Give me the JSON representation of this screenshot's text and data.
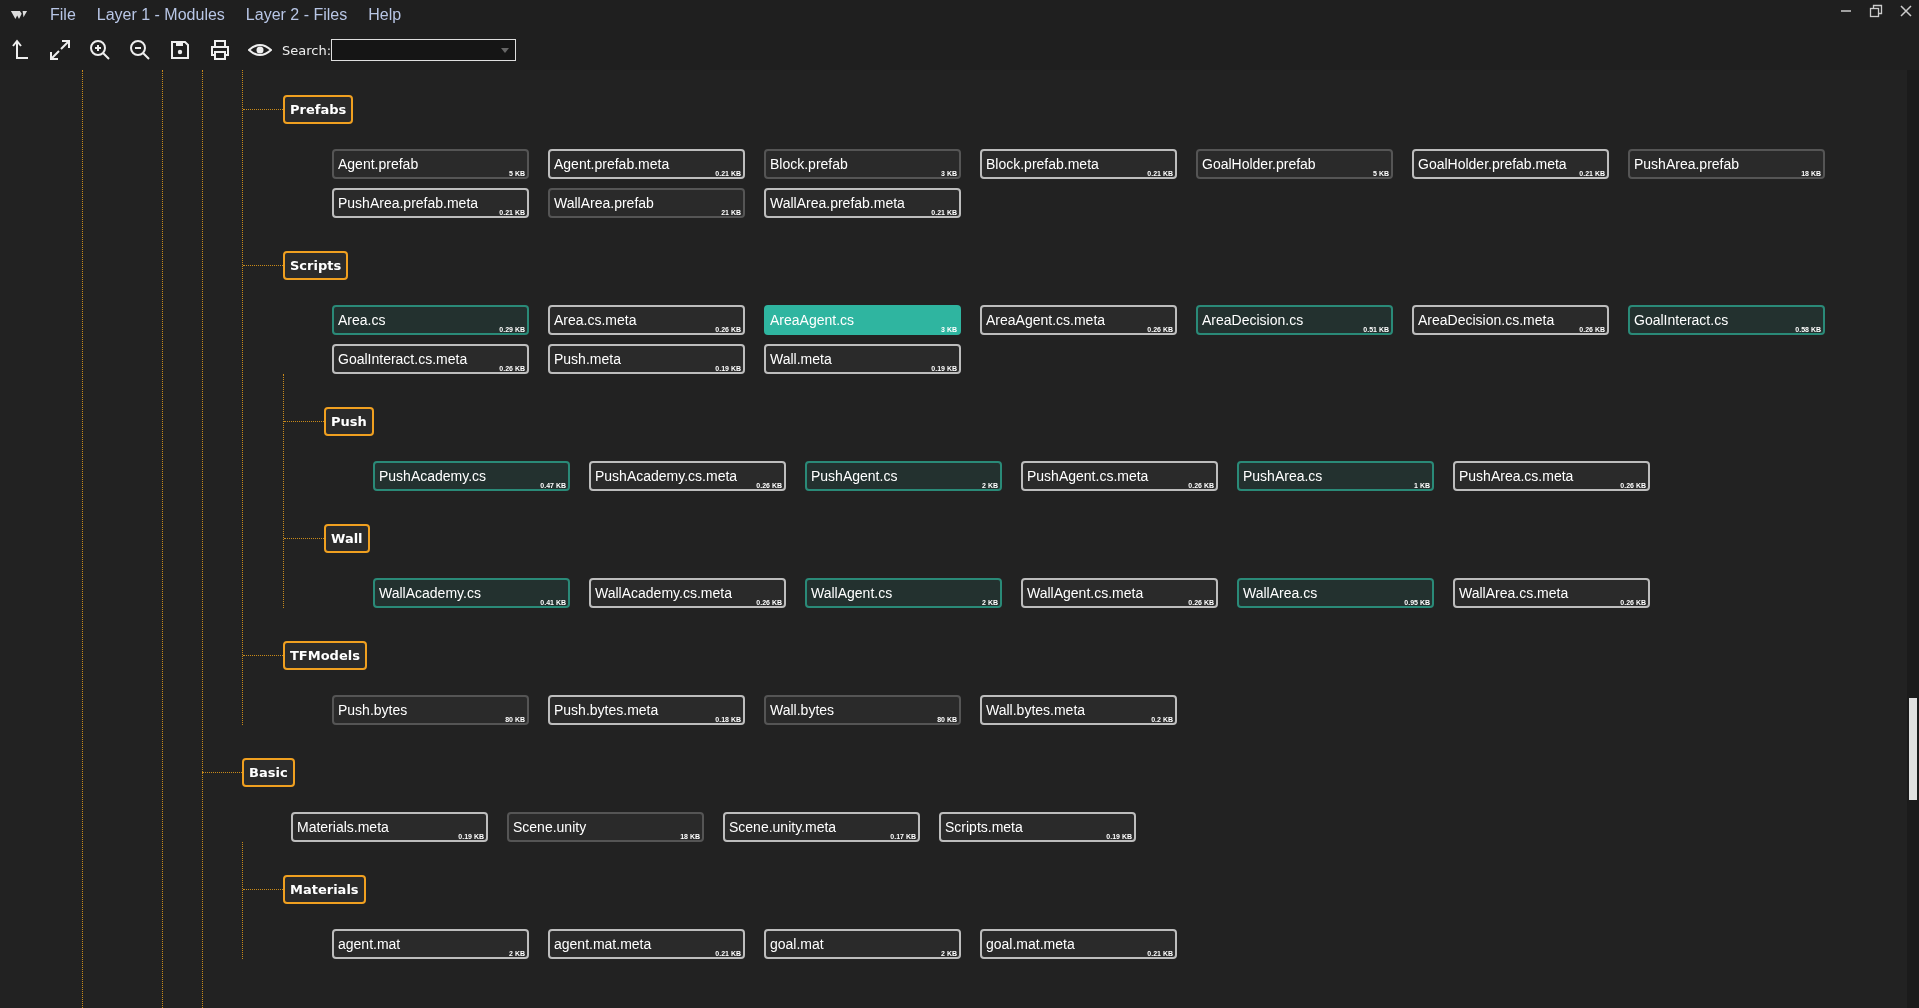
{
  "menu": [
    "File",
    "Layer 1 - Modules",
    "Layer 2 - Files",
    "Help"
  ],
  "search": {
    "label": "Search:"
  },
  "tree": [
    {
      "children": [
        {
          "name": "Prefabs",
          "files": [
            {
              "name": "Agent.prefab",
              "size": "5 KB",
              "kind": "file",
              "selected": false
            },
            {
              "name": "Agent.prefab.meta",
              "size": "0.21 KB",
              "kind": "meta",
              "selected": false
            },
            {
              "name": "Block.prefab",
              "size": "3 KB",
              "kind": "file",
              "selected": false
            },
            {
              "name": "Block.prefab.meta",
              "size": "0.21 KB",
              "kind": "meta",
              "selected": false
            },
            {
              "name": "GoalHolder.prefab",
              "size": "5 KB",
              "kind": "file",
              "selected": false
            },
            {
              "name": "GoalHolder.prefab.meta",
              "size": "0.21 KB",
              "kind": "meta",
              "selected": false
            },
            {
              "name": "PushArea.prefab",
              "size": "18 KB",
              "kind": "file",
              "selected": false
            },
            {
              "name": "PushArea.prefab.meta",
              "size": "0.21 KB",
              "kind": "meta",
              "selected": false
            },
            {
              "name": "WallArea.prefab",
              "size": "21 KB",
              "kind": "file",
              "selected": false
            },
            {
              "name": "WallArea.prefab.meta",
              "size": "0.21 KB",
              "kind": "meta",
              "selected": false
            }
          ]
        },
        {
          "name": "Scripts",
          "files": [
            {
              "name": "Area.cs",
              "size": "0.29 KB",
              "kind": "script",
              "selected": false
            },
            {
              "name": "Area.cs.meta",
              "size": "0.26 KB",
              "kind": "meta",
              "selected": false
            },
            {
              "name": "AreaAgent.cs",
              "size": "3 KB",
              "kind": "script",
              "selected": true
            },
            {
              "name": "AreaAgent.cs.meta",
              "size": "0.26 KB",
              "kind": "meta",
              "selected": false
            },
            {
              "name": "AreaDecision.cs",
              "size": "0.51 KB",
              "kind": "script",
              "selected": false
            },
            {
              "name": "AreaDecision.cs.meta",
              "size": "0.26 KB",
              "kind": "meta",
              "selected": false
            },
            {
              "name": "GoalInteract.cs",
              "size": "0.58 KB",
              "kind": "script",
              "selected": false
            },
            {
              "name": "GoalInteract.cs.meta",
              "size": "0.26 KB",
              "kind": "meta",
              "selected": false
            },
            {
              "name": "Push.meta",
              "size": "0.19 KB",
              "kind": "meta",
              "selected": false
            },
            {
              "name": "Wall.meta",
              "size": "0.19 KB",
              "kind": "meta",
              "selected": false
            }
          ],
          "children": [
            {
              "name": "Push",
              "files": [
                {
                  "name": "PushAcademy.cs",
                  "size": "0.47 KB",
                  "kind": "script",
                  "selected": false
                },
                {
                  "name": "PushAcademy.cs.meta",
                  "size": "0.26 KB",
                  "kind": "meta",
                  "selected": false
                },
                {
                  "name": "PushAgent.cs",
                  "size": "2 KB",
                  "kind": "script",
                  "selected": false
                },
                {
                  "name": "PushAgent.cs.meta",
                  "size": "0.26 KB",
                  "kind": "meta",
                  "selected": false
                },
                {
                  "name": "PushArea.cs",
                  "size": "1 KB",
                  "kind": "script",
                  "selected": false
                },
                {
                  "name": "PushArea.cs.meta",
                  "size": "0.26 KB",
                  "kind": "meta",
                  "selected": false
                }
              ]
            },
            {
              "name": "Wall",
              "files": [
                {
                  "name": "WallAcademy.cs",
                  "size": "0.41 KB",
                  "kind": "script",
                  "selected": false
                },
                {
                  "name": "WallAcademy.cs.meta",
                  "size": "0.26 KB",
                  "kind": "meta",
                  "selected": false
                },
                {
                  "name": "WallAgent.cs",
                  "size": "2 KB",
                  "kind": "script",
                  "selected": false
                },
                {
                  "name": "WallAgent.cs.meta",
                  "size": "0.26 KB",
                  "kind": "meta",
                  "selected": false
                },
                {
                  "name": "WallArea.cs",
                  "size": "0.95 KB",
                  "kind": "script",
                  "selected": false
                },
                {
                  "name": "WallArea.cs.meta",
                  "size": "0.26 KB",
                  "kind": "meta",
                  "selected": false
                }
              ]
            }
          ]
        },
        {
          "name": "TFModels",
          "files": [
            {
              "name": "Push.bytes",
              "size": "80 KB",
              "kind": "file",
              "selected": false
            },
            {
              "name": "Push.bytes.meta",
              "size": "0.18 KB",
              "kind": "meta",
              "selected": false
            },
            {
              "name": "Wall.bytes",
              "size": "80 KB",
              "kind": "file",
              "selected": false
            },
            {
              "name": "Wall.bytes.meta",
              "size": "0.2 KB",
              "kind": "meta",
              "selected": false
            }
          ]
        }
      ]
    },
    {
      "name": "Basic",
      "files": [
        {
          "name": "Materials.meta",
          "size": "0.19 KB",
          "kind": "meta",
          "selected": false
        },
        {
          "name": "Scene.unity",
          "size": "18 KB",
          "kind": "file",
          "selected": false
        },
        {
          "name": "Scene.unity.meta",
          "size": "0.17 KB",
          "kind": "meta",
          "selected": false
        },
        {
          "name": "Scripts.meta",
          "size": "0.19 KB",
          "kind": "meta",
          "selected": false
        }
      ],
      "children": [
        {
          "name": "Materials",
          "files": [
            {
              "name": "agent.mat",
              "size": "2 KB",
              "kind": "meta",
              "selected": false
            },
            {
              "name": "agent.mat.meta",
              "size": "0.21 KB",
              "kind": "meta",
              "selected": false
            },
            {
              "name": "goal.mat",
              "size": "2 KB",
              "kind": "meta",
              "selected": false
            },
            {
              "name": "goal.mat.meta",
              "size": "0.21 KB",
              "kind": "meta",
              "selected": false
            }
          ]
        }
      ]
    }
  ]
}
